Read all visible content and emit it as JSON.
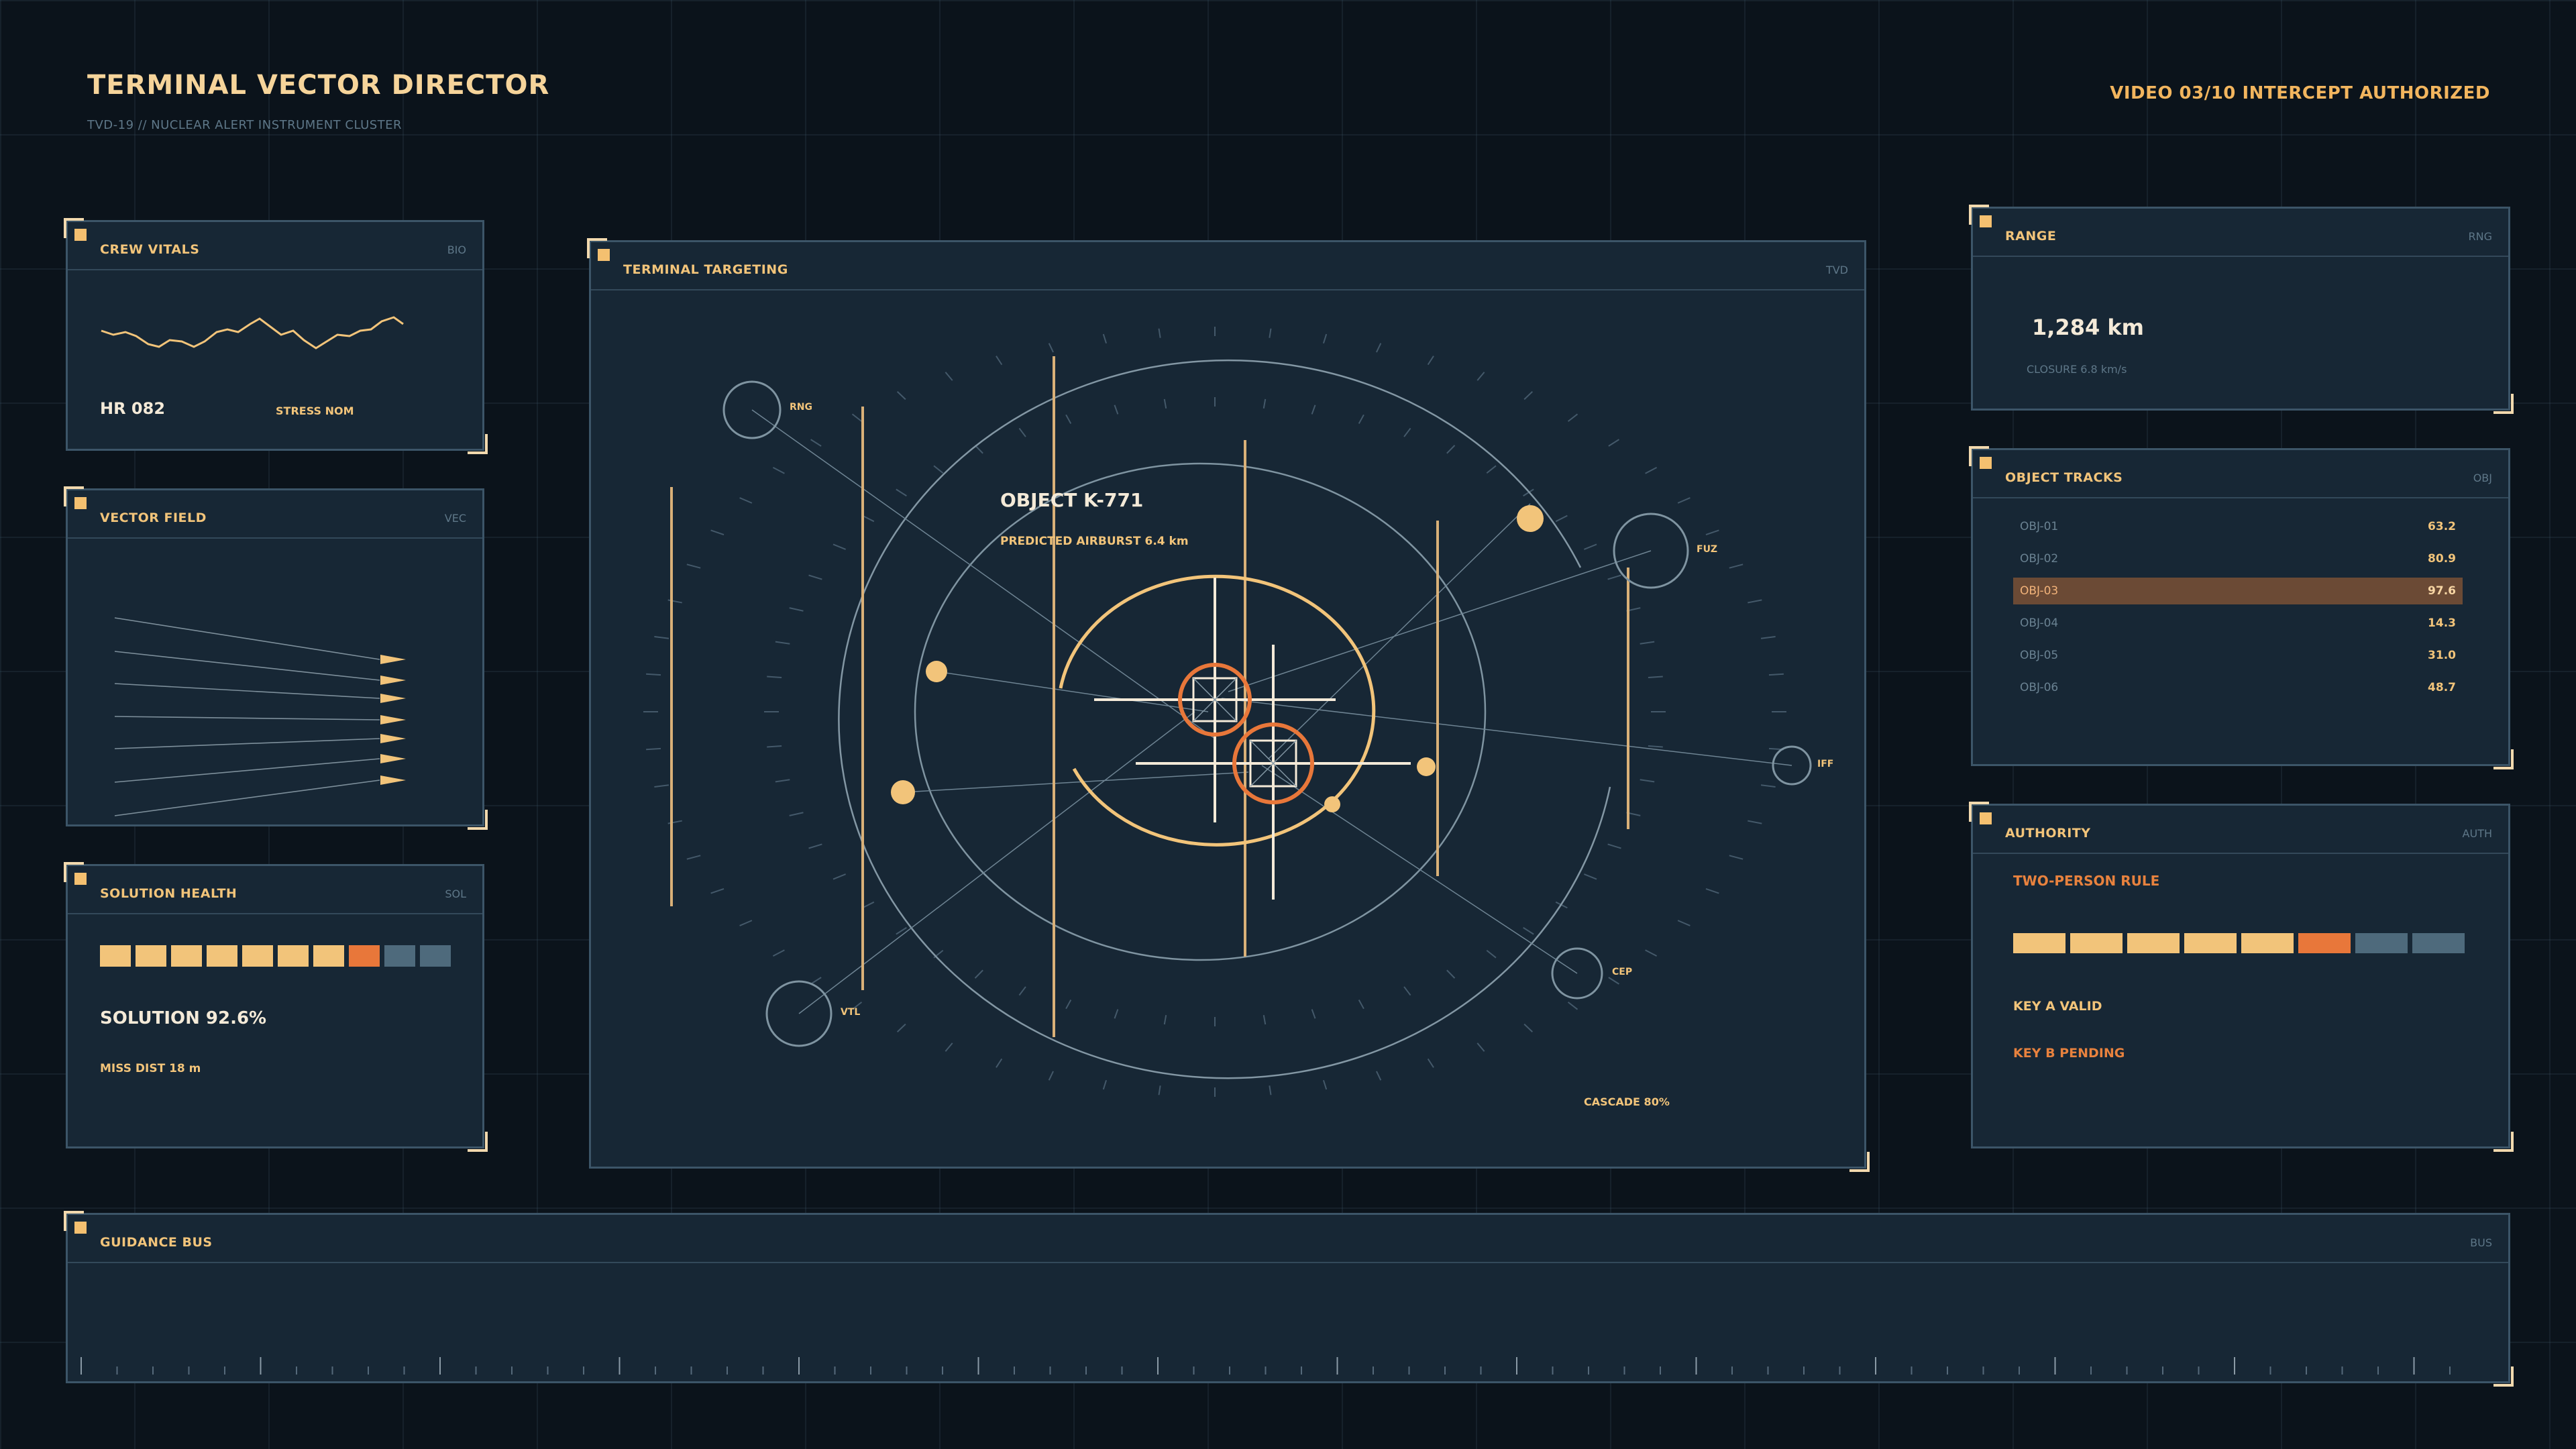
{
  "header": {
    "title": "TERMINAL VECTOR DIRECTOR",
    "subtitle": "TVD-19 // NUCLEAR ALERT INSTRUMENT CLUSTER",
    "status": "VIDEO 03/10  INTERCEPT AUTHORIZED"
  },
  "panels": {
    "crew_vitals": {
      "title": "CREW VITALS",
      "code": "BIO",
      "hr": "HR 082",
      "stress": "STRESS NOM"
    },
    "vector_field": {
      "title": "VECTOR FIELD",
      "code": "VEC"
    },
    "solution_health": {
      "title": "SOLUTION HEALTH",
      "code": "SOL",
      "solution": "SOLUTION 92.6%",
      "miss": "MISS DIST 18 m",
      "segments": [
        "on",
        "on",
        "on",
        "on",
        "on",
        "on",
        "on",
        "alert",
        "off",
        "off"
      ]
    },
    "targeting": {
      "title": "TERMINAL TARGETING",
      "code": "TVD",
      "object": "OBJECT K-771",
      "airburst": "PREDICTED AIRBURST  6.4 km",
      "cascade": "CASCADE 80%",
      "labels": {
        "rng": "RNG",
        "fuz": "FUZ",
        "iff": "IFF",
        "cep": "CEP",
        "vtl": "VTL"
      }
    },
    "range": {
      "title": "RANGE",
      "code": "RNG",
      "value": "1,284 km",
      "closure": "CLOSURE 6.8 km/s"
    },
    "object_tracks": {
      "title": "OBJECT TRACKS",
      "code": "OBJ",
      "rows": [
        {
          "id": "OBJ-01",
          "value": "63.2"
        },
        {
          "id": "OBJ-02",
          "value": "80.9"
        },
        {
          "id": "OBJ-03",
          "value": "97.6"
        },
        {
          "id": "OBJ-04",
          "value": "14.3"
        },
        {
          "id": "OBJ-05",
          "value": "31.0"
        },
        {
          "id": "OBJ-06",
          "value": "48.7"
        }
      ]
    },
    "authority": {
      "title": "AUTHORITY",
      "code": "AUTH",
      "rule": "TWO-PERSON RULE",
      "key_a": "KEY A  VALID",
      "key_b": "KEY B  PENDING",
      "segments": [
        "on",
        "on",
        "on",
        "on",
        "on",
        "alert",
        "off",
        "off"
      ]
    },
    "guidance_bus": {
      "title": "GUIDANCE BUS",
      "code": "BUS"
    }
  },
  "colors": {
    "background": "#0b131b",
    "panel": "#172735",
    "accent": "#f2c47a",
    "alert": "#e8773a",
    "muted": "#5e7788",
    "highlight_row": "#6b4a35"
  }
}
